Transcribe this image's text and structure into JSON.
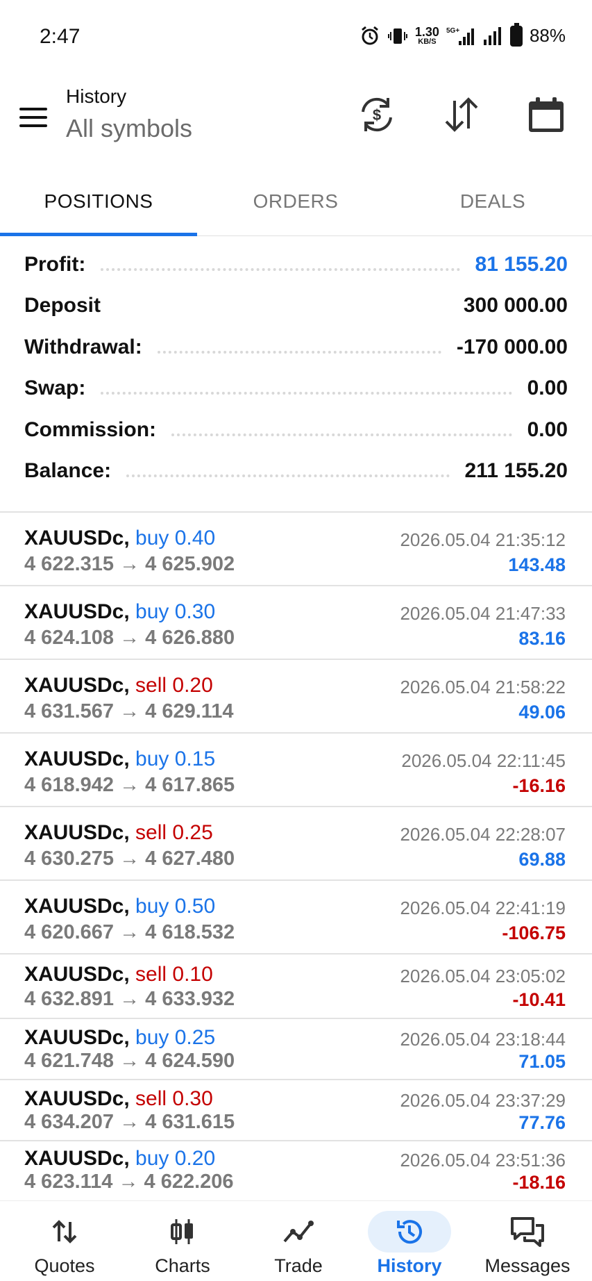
{
  "status_bar": {
    "time": "2:47",
    "net_speed": "1.30",
    "net_unit": "KB/S",
    "network": "5G+",
    "battery": "88%"
  },
  "app_bar": {
    "title": "History",
    "subtitle": "All symbols",
    "icons": [
      "menu-icon",
      "currency-exchange-icon",
      "sort-icon",
      "calendar-icon"
    ]
  },
  "tabs": [
    {
      "label": "POSITIONS",
      "active": true
    },
    {
      "label": "ORDERS",
      "active": false
    },
    {
      "label": "DEALS",
      "active": false
    }
  ],
  "summary": [
    {
      "label": "Profit:",
      "value": "81 155.20",
      "highlight": true
    },
    {
      "label": "Deposit",
      "value": "300 000.00",
      "highlight": false
    },
    {
      "label": "Withdrawal:",
      "value": "-170 000.00",
      "highlight": false
    },
    {
      "label": "Swap:",
      "value": "0.00",
      "highlight": false
    },
    {
      "label": "Commission:",
      "value": "0.00",
      "highlight": false
    },
    {
      "label": "Balance:",
      "value": "211 155.20",
      "highlight": false
    }
  ],
  "trades": [
    {
      "symbol": "XAUUSDc,",
      "direction": "buy 0.40",
      "side": "buy",
      "open": "4 622.315",
      "arrow": "→",
      "close": "4 625.902",
      "time": "2026.05.04 21:35:12",
      "profit": "143.48",
      "sign": "pos"
    },
    {
      "symbol": "XAUUSDc,",
      "direction": "buy 0.30",
      "side": "buy",
      "open": "4 624.108",
      "arrow": "→",
      "close": "4 626.880",
      "time": "2026.05.04 21:47:33",
      "profit": "83.16",
      "sign": "pos"
    },
    {
      "symbol": "XAUUSDc,",
      "direction": "sell 0.20",
      "side": "sell",
      "open": "4 631.567",
      "arrow": "→",
      "close": "4 629.114",
      "time": "2026.05.04 21:58:22",
      "profit": "49.06",
      "sign": "pos"
    },
    {
      "symbol": "XAUUSDc,",
      "direction": "buy 0.15",
      "side": "buy",
      "open": "4 618.942",
      "arrow": "→",
      "close": "4 617.865",
      "time": "2026.05.04 22:11:45",
      "profit": "-16.16",
      "sign": "neg"
    },
    {
      "symbol": "XAUUSDc,",
      "direction": "sell 0.25",
      "side": "sell",
      "open": "4 630.275",
      "arrow": "→",
      "close": "4 627.480",
      "time": "2026.05.04 22:28:07",
      "profit": "69.88",
      "sign": "pos"
    },
    {
      "symbol": "XAUUSDc,",
      "direction": "buy 0.50",
      "side": "buy",
      "open": "4 620.667",
      "arrow": "→",
      "close": "4 618.532",
      "time": "2026.05.04 22:41:19",
      "profit": "-106.75",
      "sign": "neg"
    },
    {
      "symbol": "XAUUSDc,",
      "direction": "sell 0.10",
      "side": "sell",
      "open": "4 632.891",
      "arrow": "→",
      "close": "4 633.932",
      "time": "2026.05.04 23:05:02",
      "profit": "-10.41",
      "sign": "neg"
    },
    {
      "symbol": "XAUUSDc,",
      "direction": "buy 0.25",
      "side": "buy",
      "open": "4 621.748",
      "arrow": "→",
      "close": "4 624.590",
      "time": "2026.05.04 23:18:44",
      "profit": "71.05",
      "sign": "pos"
    },
    {
      "symbol": "XAUUSDc,",
      "direction": "sell 0.30",
      "side": "sell",
      "open": "4 634.207",
      "arrow": "→",
      "close": "4 631.615",
      "time": "2026.05.04 23:37:29",
      "profit": "77.76",
      "sign": "pos"
    },
    {
      "symbol": "XAUUSDc,",
      "direction": "buy 0.20",
      "side": "buy",
      "open": "4 623.114",
      "arrow": "→",
      "close": "4 622.206",
      "time": "2026.05.04 23:51:36",
      "profit": "-18.16",
      "sign": "neg"
    }
  ],
  "bottom_nav": [
    {
      "label": "Quotes",
      "icon": "quotes-icon",
      "active": false
    },
    {
      "label": "Charts",
      "icon": "charts-icon",
      "active": false
    },
    {
      "label": "Trade",
      "icon": "trade-icon",
      "active": false
    },
    {
      "label": "History",
      "icon": "history-icon",
      "active": true
    },
    {
      "label": "Messages",
      "icon": "messages-icon",
      "active": false
    }
  ],
  "colors": {
    "accent": "#1a73e8",
    "loss": "#c40000",
    "muted": "#7a7a7a"
  }
}
